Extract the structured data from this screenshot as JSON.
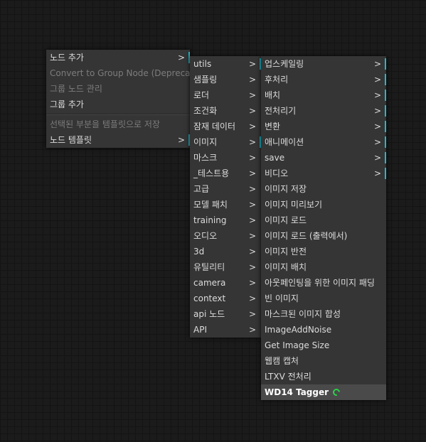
{
  "menu1": {
    "items": [
      {
        "label": "노드 추가",
        "arrow": ">"
      },
      {
        "label": "Convert to Group Node (Deprecated)"
      },
      {
        "label": "그룹 노드 관리"
      },
      {
        "label": "그룹 추가"
      },
      {
        "label": "선택된 부분을 템플릿으로 저장"
      },
      {
        "label": "노드 템플릿",
        "arrow": ">"
      }
    ]
  },
  "menu2": {
    "items": [
      {
        "label": "utils",
        "arrow": ">"
      },
      {
        "label": "샘플링",
        "arrow": ">"
      },
      {
        "label": "로더",
        "arrow": ">"
      },
      {
        "label": "조건화",
        "arrow": ">"
      },
      {
        "label": "잠재 데이터",
        "arrow": ">"
      },
      {
        "label": "이미지",
        "arrow": ">"
      },
      {
        "label": "마스크",
        "arrow": ">"
      },
      {
        "label": "_테스트용",
        "arrow": ">"
      },
      {
        "label": "고급",
        "arrow": ">"
      },
      {
        "label": "모델 패치",
        "arrow": ">"
      },
      {
        "label": "training",
        "arrow": ">"
      },
      {
        "label": "오디오",
        "arrow": ">"
      },
      {
        "label": "3d",
        "arrow": ">"
      },
      {
        "label": "유틸리티",
        "arrow": ">"
      },
      {
        "label": "camera",
        "arrow": ">"
      },
      {
        "label": "context",
        "arrow": ">"
      },
      {
        "label": "api 노드",
        "arrow": ">"
      },
      {
        "label": "API",
        "arrow": ">"
      }
    ]
  },
  "menu3": {
    "items": [
      {
        "label": "업스케일링",
        "arrow": ">"
      },
      {
        "label": "후처리",
        "arrow": ">"
      },
      {
        "label": "배치",
        "arrow": ">"
      },
      {
        "label": "전처리기",
        "arrow": ">"
      },
      {
        "label": "변환",
        "arrow": ">"
      },
      {
        "label": "애니메이션",
        "arrow": ">"
      },
      {
        "label": "save",
        "arrow": ">"
      },
      {
        "label": "비디오",
        "arrow": ">"
      },
      {
        "label": "이미지 저장"
      },
      {
        "label": "이미지 미리보기"
      },
      {
        "label": "이미지 로드"
      },
      {
        "label": "이미지 로드 (출력에서)"
      },
      {
        "label": "이미지 반전"
      },
      {
        "label": "이미지 배치"
      },
      {
        "label": "아웃페인팅을 위한 이미지 패딩"
      },
      {
        "label": "빈 이미지"
      },
      {
        "label": "마스크된 이미지 합성"
      },
      {
        "label": "ImageAddNoise"
      },
      {
        "label": "Get Image Size"
      },
      {
        "label": "웹캠 캡처"
      },
      {
        "label": "LTXV 전처리"
      },
      {
        "label": "WD14 Tagger",
        "badge": "custom-node-icon"
      }
    ]
  },
  "colors": {
    "accent": "#22b7c9",
    "badge": "#2bd34a",
    "menu_bg": "#353535",
    "canvas_bg": "#1b1b1b"
  }
}
